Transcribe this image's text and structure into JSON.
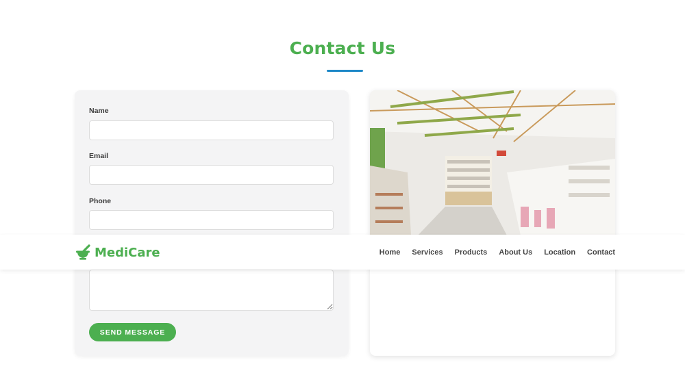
{
  "colors": {
    "brand": "#4caf50",
    "accent": "#1e88c7"
  },
  "section": {
    "title": "Contact Us"
  },
  "form": {
    "fields": [
      {
        "label": "Name",
        "value": "",
        "placeholder": ""
      },
      {
        "label": "Email",
        "value": "",
        "placeholder": ""
      },
      {
        "label": "Phone",
        "value": "",
        "placeholder": ""
      }
    ],
    "message": {
      "value": ""
    },
    "submit_label": "SEND MESSAGE"
  },
  "navbar": {
    "brand_name": "MediCare",
    "brand_icon": "mortar-pestle-icon",
    "links": [
      "Home",
      "Services",
      "Products",
      "About Us",
      "Location",
      "Contact"
    ]
  },
  "image": {
    "subject": "pharmacy-store-interior-photo"
  }
}
